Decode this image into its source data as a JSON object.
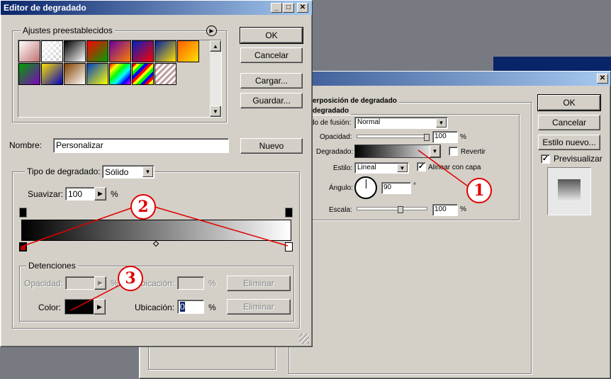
{
  "editor": {
    "title": "Editor de degradado",
    "presets_label": "Ajustes preestablecidos",
    "buttons": {
      "ok": "OK",
      "cancel": "Cancelar",
      "load": "Cargar...",
      "save": "Guardar...",
      "new": "Nuevo"
    },
    "name_label": "Nombre:",
    "name_value": "Personalizar",
    "gradient_type_label": "Tipo de degradado:",
    "gradient_type_value": "Sólido",
    "smooth_label": "Suavizar:",
    "smooth_value": "100",
    "percent": "%",
    "stops_label": "Detenciones",
    "opacity_label": "Opacidad:",
    "location_label": "Ubicación:",
    "delete_label": "Eliminar",
    "color_label": "Color:",
    "location_value": "0"
  },
  "layer_style": {
    "section_title": "erposición de degradado",
    "subsection_title": "degradado",
    "blend_label": "do de fusión:",
    "blend_value": "Normal",
    "opacity_label": "Opacidad:",
    "opacity_value": "100",
    "gradient_label": "Degradado:",
    "reverse_label": "Revertir",
    "style_label": "Estilo:",
    "style_value": "Lineal",
    "align_label": "Alinear con capa",
    "angle_label": "Ángulo:",
    "angle_value": "90",
    "degree": "°",
    "scale_label": "Escala:",
    "scale_value": "100",
    "percent": "%",
    "buttons": {
      "ok": "OK",
      "cancel": "Cancelar",
      "new_style": "Estilo nuevo..."
    },
    "preview_label": "Previsualizar"
  },
  "annotations": [
    "1",
    "2",
    "3"
  ],
  "preset_swatches": [
    [
      "#ffffff",
      "#c07070"
    ],
    [
      "checker",
      "#ffffff"
    ],
    [
      "#000000",
      "#ffffff"
    ],
    [
      "#ff0000",
      "#00a000"
    ],
    [
      "#6a00a0",
      "#ff8000"
    ],
    [
      "#0020c0",
      "#ff0000"
    ],
    [
      "#0020a0",
      "#ffe000"
    ],
    [
      "#ff6000",
      "#ffe000"
    ],
    [
      "#00a000",
      "#8000c0"
    ],
    [
      "#ffe000",
      "#0000c0"
    ],
    [
      "#804000",
      "#ffffff"
    ],
    [
      "#0040c0",
      "#ffff00"
    ],
    [
      "rainbow",
      "rainbow"
    ],
    [
      "rainbow2",
      "rainbow2"
    ],
    [
      "stripes",
      "stripes"
    ]
  ]
}
